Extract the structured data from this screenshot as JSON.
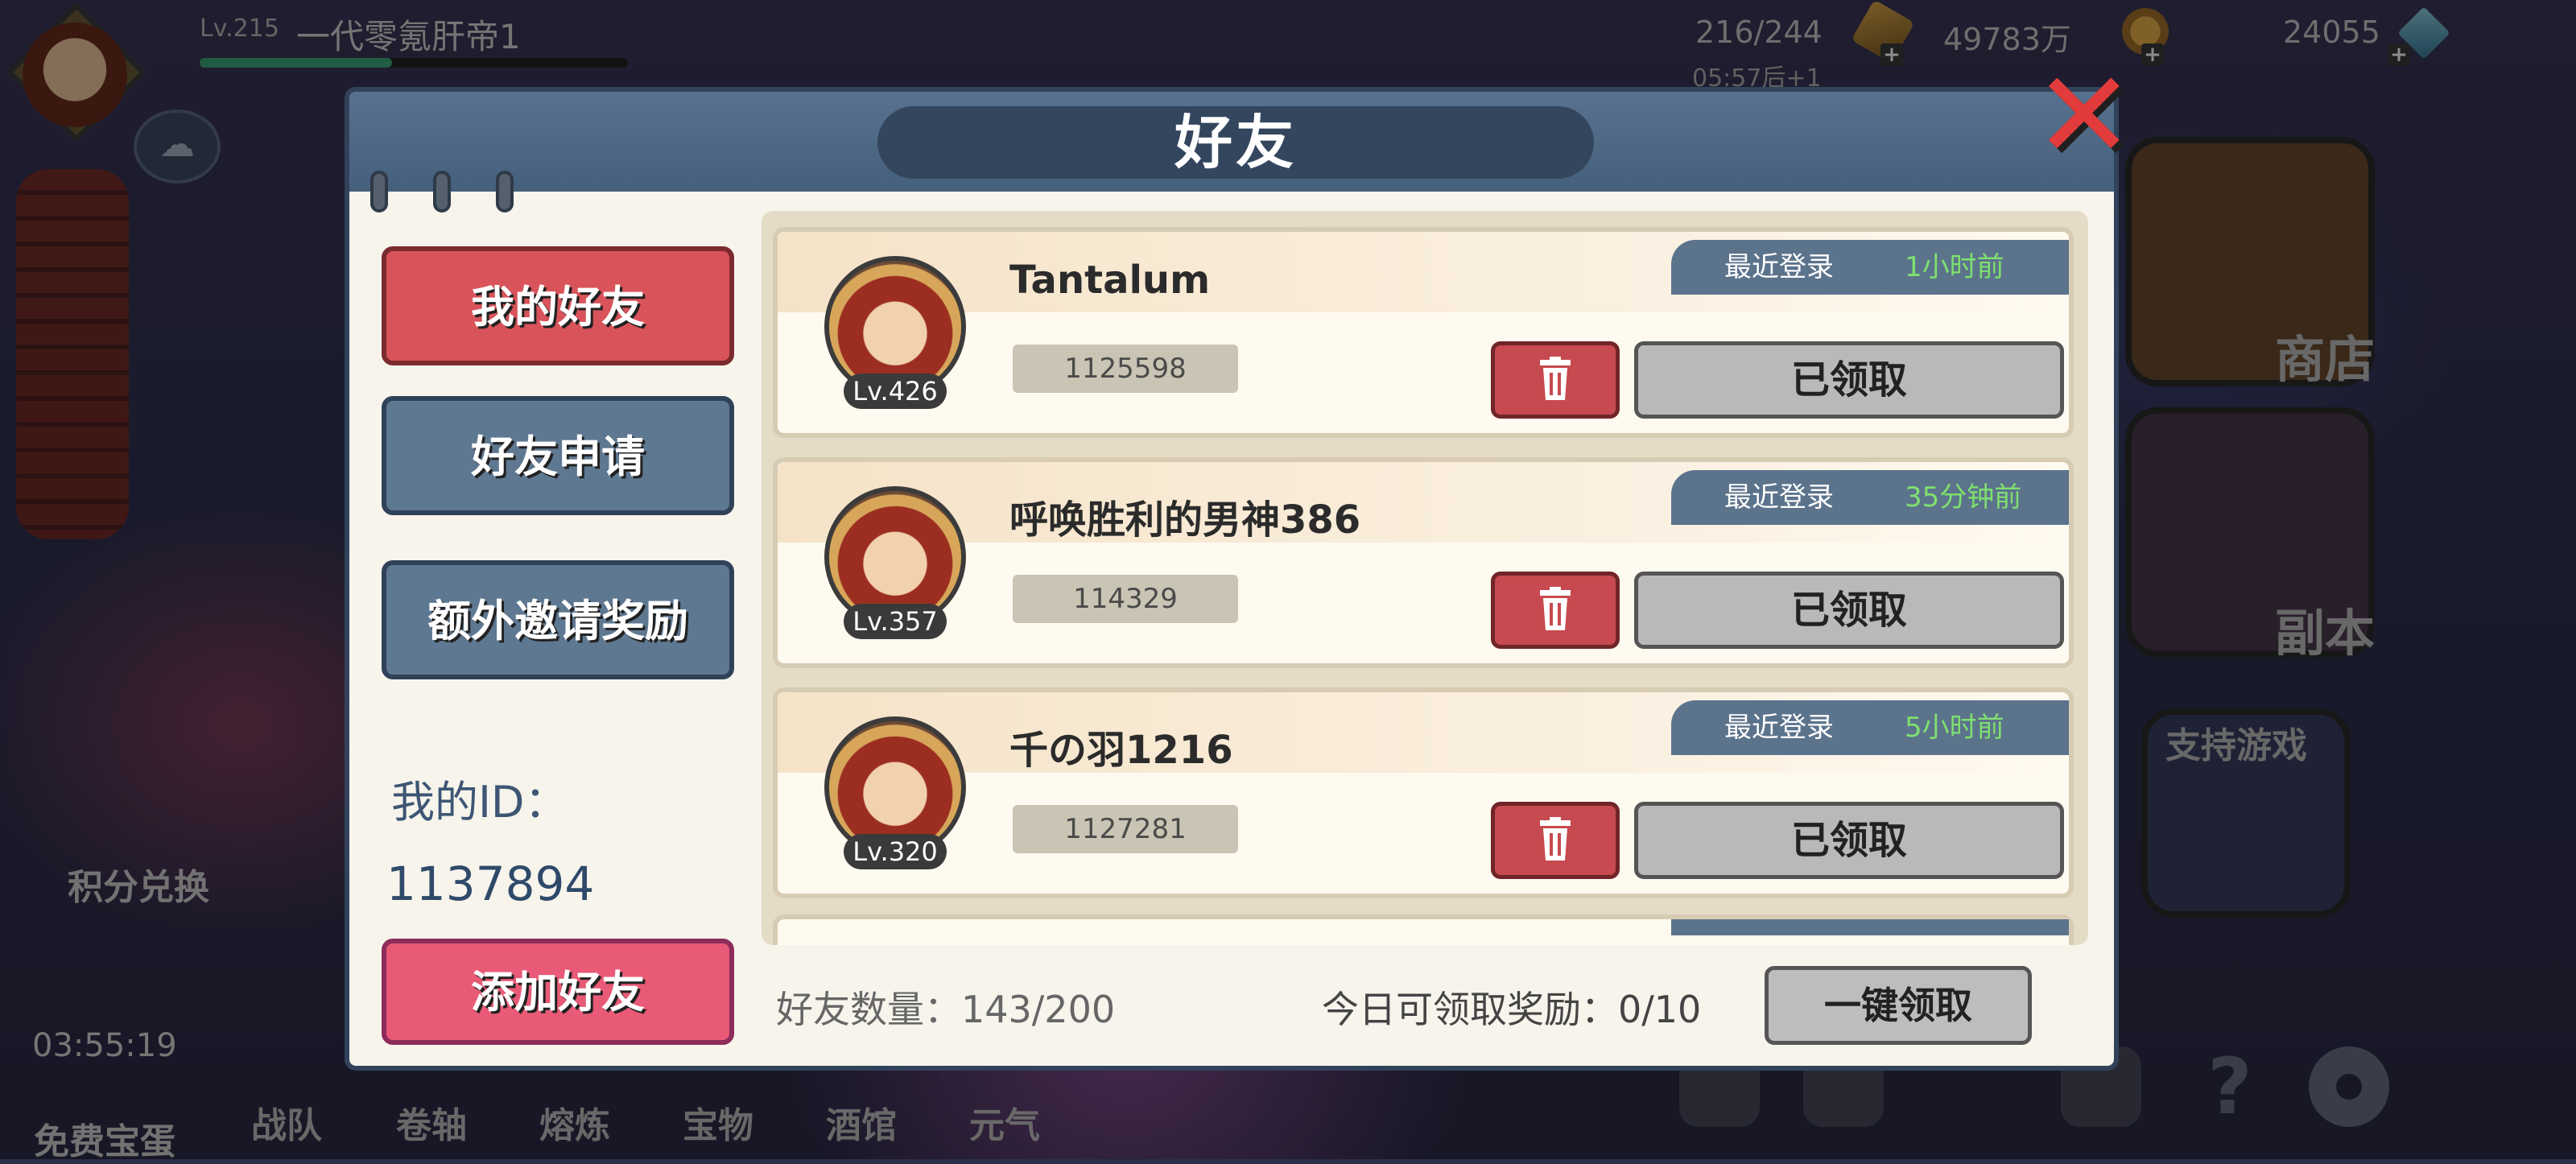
{
  "hud": {
    "level": "Lv.215",
    "player_name": "一代零氪肝帝1",
    "exp_progress": 0.45,
    "stamina": "216/244",
    "stamina_timer": "05:57后+1",
    "gold": "49783万",
    "gems": "24055"
  },
  "left_side": {
    "points_exchange": "积分兑换",
    "free_egg": "免费宝蛋",
    "egg_timer": "03:55:19"
  },
  "right_side": {
    "shop": "商店",
    "dungeon": "副本",
    "support": "支持游戏"
  },
  "bottom_nav": [
    "战队",
    "卷轴",
    "熔炼",
    "宝物",
    "酒馆",
    "元气"
  ],
  "dialog": {
    "title": "好友",
    "close_icon": "close-icon",
    "menu": {
      "my_friends": "我的好友",
      "friend_requests": "好友申请",
      "invite_rewards": "额外邀请奖励",
      "add_friend": "添加好友"
    },
    "my_id_label": "我的ID：",
    "my_id_value": "1137894",
    "friends": [
      {
        "level": "Lv.426",
        "name": "Tantalum",
        "id": "1125598",
        "login_label": "最近登录",
        "login_time": "1小时前",
        "claim_label": "已领取"
      },
      {
        "level": "Lv.357",
        "name": "呼唤胜利的男神386",
        "id": "114329",
        "login_label": "最近登录",
        "login_time": "35分钟前",
        "claim_label": "已领取"
      },
      {
        "level": "Lv.320",
        "name": "千の羽1216",
        "id": "1127281",
        "login_label": "最近登录",
        "login_time": "5小时前",
        "claim_label": "已领取"
      }
    ],
    "friend_count": "好友数量：143/200",
    "today_rewards": "今日可领取奖励：0/10",
    "claim_all": "一键领取"
  },
  "colors": {
    "active_tab": "#d9535a",
    "normal_tab": "#5f7892",
    "add_button": "#e85a76",
    "login_time": "#7ee06f",
    "delete_button": "#c64a4f"
  }
}
